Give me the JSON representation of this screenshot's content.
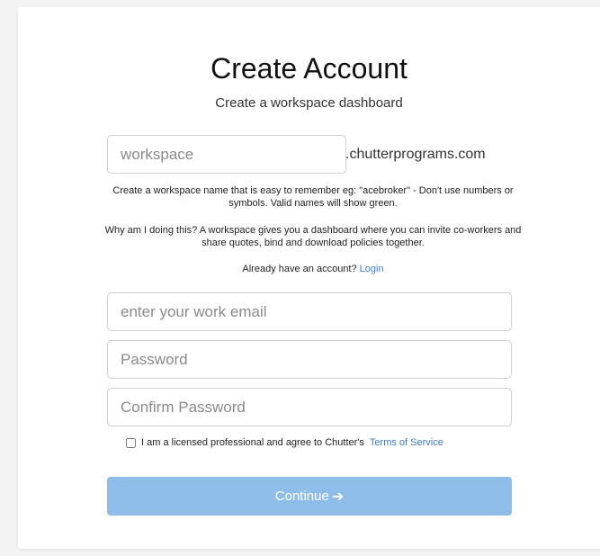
{
  "header": {
    "title": "Create Account",
    "subtitle": "Create a workspace dashboard"
  },
  "workspace": {
    "placeholder": "workspace",
    "value": "",
    "domain_suffix": ".chutterprograms.com",
    "help_text": "Create a workspace name that is easy to remember eg: \"acebroker\" - Don't use numbers or symbols. Valid names will show green.",
    "why_text": "Why am I doing this? A workspace gives you a dashboard where you can invite co-workers and share quotes, bind and download policies together."
  },
  "login": {
    "prompt": "Already have an account?",
    "link_label": "Login"
  },
  "fields": {
    "email_placeholder": "enter your work email",
    "password_placeholder": "Password",
    "confirm_placeholder": "Confirm Password"
  },
  "terms": {
    "checked": false,
    "label": "I am a licensed professional and agree to Chutter's",
    "link_label": "Terms of Service"
  },
  "continue_button": {
    "label": "Continue",
    "icon": "arrow-right-icon"
  },
  "colors": {
    "link": "#3a7dc4",
    "button": "#8dbde8"
  }
}
